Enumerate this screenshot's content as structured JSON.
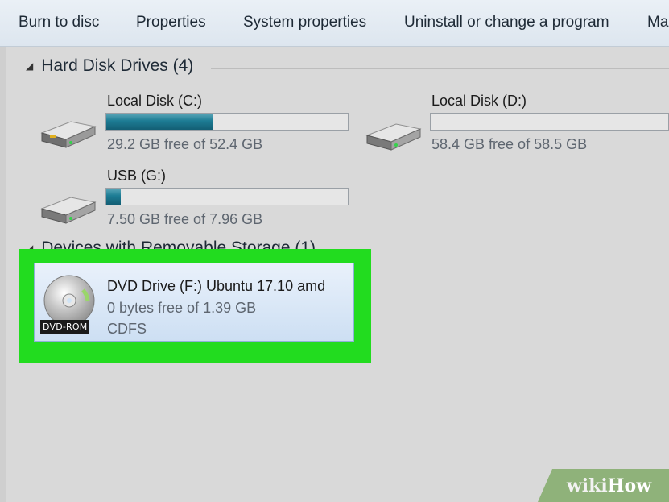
{
  "toolbar": {
    "items": [
      "Burn to disc",
      "Properties",
      "System properties",
      "Uninstall or change a program",
      "Ma"
    ]
  },
  "hard_disk_group": {
    "label": "Hard Disk Drives (4)"
  },
  "drives": [
    {
      "name": "Local Disk (C:)",
      "free": "29.2 GB free of 52.4 GB",
      "used_fraction": 0.44
    },
    {
      "name": "Local Disk (D:)",
      "free": "58.4 GB free of 58.5 GB",
      "used_fraction": 0.0
    },
    {
      "name": "USB (G:)",
      "free": "7.50 GB free of 7.96 GB",
      "used_fraction": 0.06
    }
  ],
  "removable_group": {
    "label": "Devices with Removable Storage (1)"
  },
  "dvd": {
    "name": "DVD Drive (F:) Ubuntu 17.10 amd",
    "free": "0 bytes free of 1.39 GB",
    "fs": "CDFS",
    "badge": "DVD-ROM"
  },
  "watermark": {
    "wiki": "wiki",
    "how": "How"
  },
  "colors": {
    "highlight": "#22dc1f",
    "bar_fill": "#1d7c94",
    "tile_bg": "#cddff3"
  },
  "icons": {
    "hdd": "hard-drive-icon",
    "dvd": "dvd-disc-icon",
    "group_toggle": "collapse-triangle-icon"
  }
}
